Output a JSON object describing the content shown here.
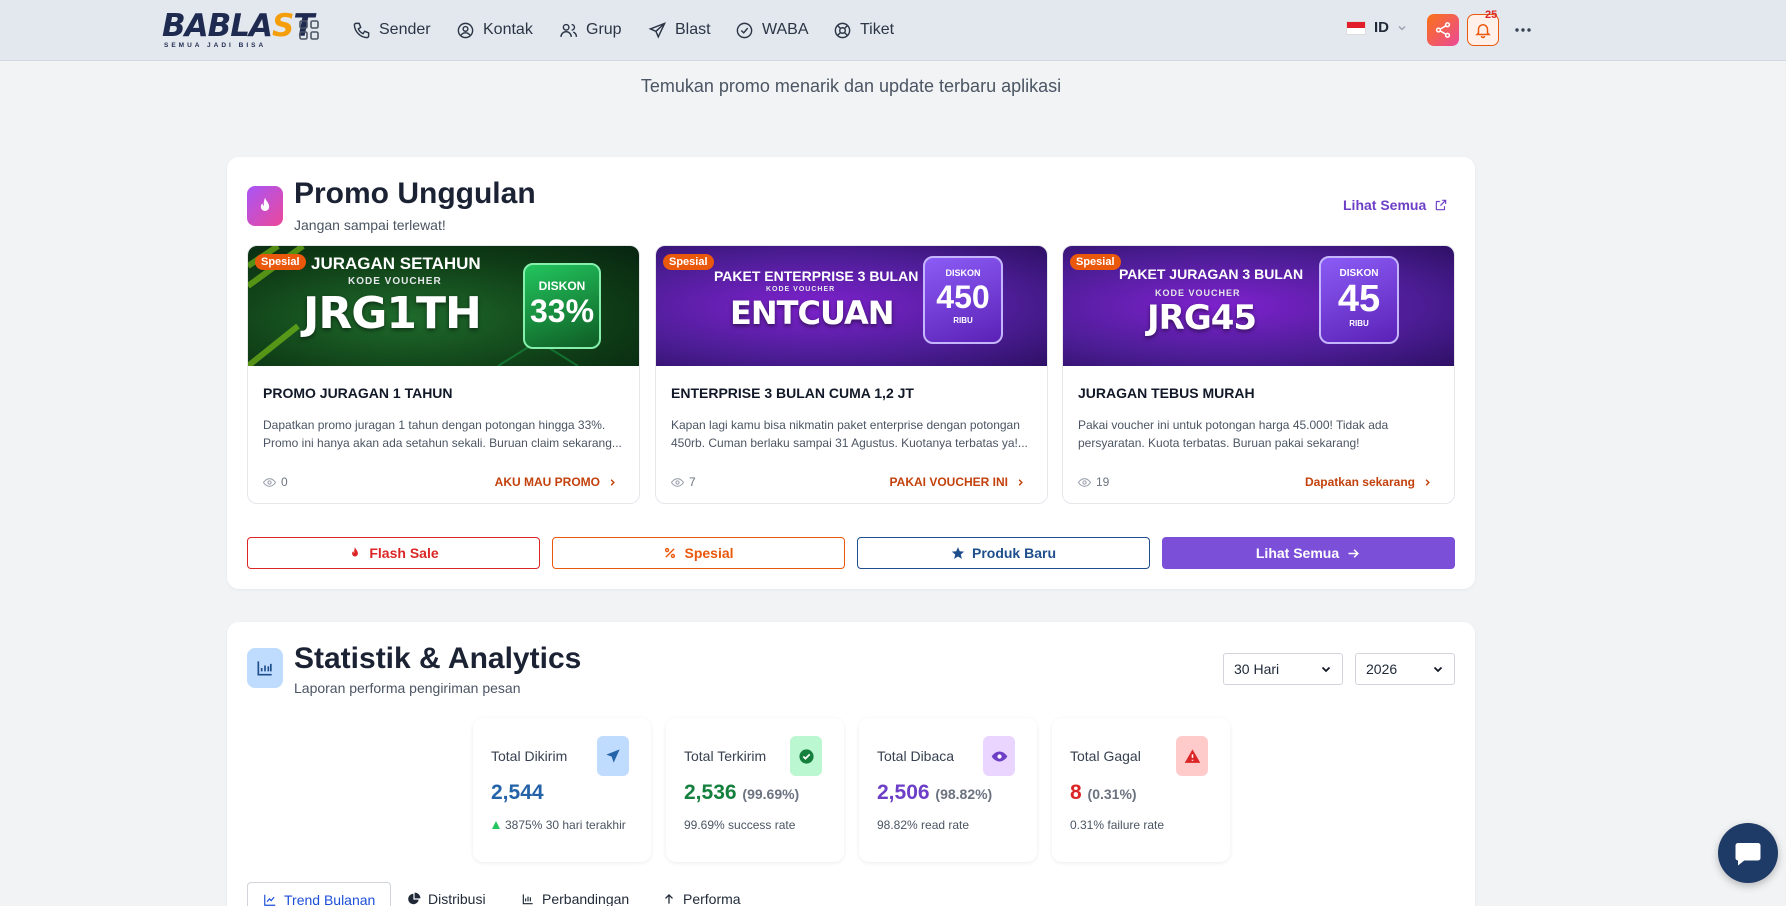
{
  "nav": {
    "logo_main": "BABLA",
    "logo_o": "S",
    "logo_end": "T",
    "logo_tagline": "SEMUA JADI BISA",
    "items": [
      {
        "label": "Sender",
        "icon": "phone-icon"
      },
      {
        "label": "Kontak",
        "icon": "user-circle-icon"
      },
      {
        "label": "Grup",
        "icon": "users-icon"
      },
      {
        "label": "Blast",
        "icon": "send-icon"
      },
      {
        "label": "WABA",
        "icon": "check-circle-icon"
      },
      {
        "label": "Tiket",
        "icon": "lifebuoy-icon"
      }
    ],
    "lang": "ID",
    "notif_count": "25"
  },
  "subtitle": "Temukan promo menarik dan update terbaru aplikasi",
  "promo": {
    "title": "Promo Unggulan",
    "subtitle": "Jangan sampai terlewat!",
    "see_all": "Lihat Semua",
    "items": [
      {
        "tag": "Spesial",
        "banner_head": "JURAGAN SETAHUN",
        "banner_kode": "KODE VOUCHER",
        "banner_code": "JRG1TH",
        "banner_disc_label": "DISKON",
        "banner_disc_value": "33%",
        "title": "PROMO JURAGAN 1 TAHUN",
        "desc": "Dapatkan promo juragan 1 tahun dengan potongan hingga 33%. Promo ini hanya akan ada setahun sekali. Buruan claim sekarang...",
        "views": "0",
        "cta": "AKU MAU PROMO"
      },
      {
        "tag": "Spesial",
        "banner_head": "PAKET ENTERPRISE 3 BULAN",
        "banner_kode": "KODE VOUCHER",
        "banner_code": "ENTCUAN",
        "banner_disc_label": "DISKON",
        "banner_disc_value": "450",
        "banner_disc_unit": "RIBU",
        "title": "ENTERPRISE 3 BULAN CUMA 1,2 JT",
        "desc": "Kapan lagi kamu bisa nikmatin paket enterprise dengan potongan 450rb. Cuman berlaku sampai 31 Agustus. Kuotanya terbatas ya!...",
        "views": "7",
        "cta": "PAKAI VOUCHER INI"
      },
      {
        "tag": "Spesial",
        "banner_head": "PAKET JURAGAN 3 BULAN",
        "banner_kode": "KODE VOUCHER",
        "banner_code": "JRG45",
        "banner_disc_label": "DISKON",
        "banner_disc_value": "45",
        "banner_disc_unit": "RIBU",
        "title": "JURAGAN TEBUS MURAH",
        "desc": "Pakai voucher ini untuk potongan harga 45.000! Tidak ada persyaratan. Kuota terbatas. Buruan pakai sekarang!",
        "views": "19",
        "cta": "Dapatkan sekarang"
      }
    ],
    "categories": {
      "flash": "Flash Sale",
      "spesial": "Spesial",
      "baru": "Produk Baru",
      "all": "Lihat Semua"
    }
  },
  "stats": {
    "title": "Statistik & Analytics",
    "subtitle": "Laporan performa pengiriman pesan",
    "range_select": "30 Hari",
    "year_select": "2026",
    "cards": [
      {
        "label": "Total Dikirim",
        "value": "2,544",
        "pct": "",
        "note": "3875% 30 hari terakhir",
        "color": "#2563a8"
      },
      {
        "label": "Total Terkirim",
        "value": "2,536",
        "pct": "(99.69%)",
        "note": "99.69% success rate",
        "color": "#15803d"
      },
      {
        "label": "Total Dibaca",
        "value": "2,506",
        "pct": "(98.82%)",
        "note": "98.82% read rate",
        "color": "#6d3fc7"
      },
      {
        "label": "Total Gagal",
        "value": "8",
        "pct": "(0.31%)",
        "note": "0.31% failure rate",
        "color": "#dc2626"
      }
    ],
    "tabs": [
      "Trend Bulanan",
      "Distribusi",
      "Perbandingan",
      "Performa"
    ]
  }
}
